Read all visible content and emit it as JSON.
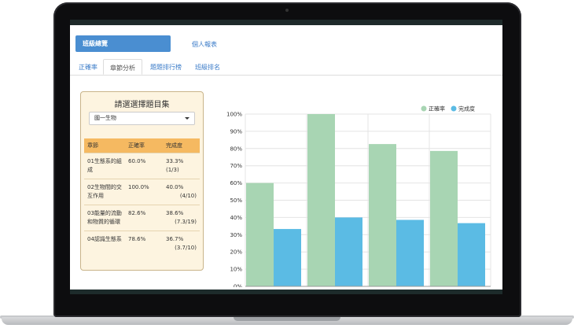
{
  "header": {
    "overview_button": "班級總覽",
    "personal_report_link": "個人報表"
  },
  "tabs": [
    {
      "label": "正確率",
      "active": false
    },
    {
      "label": "章節分析",
      "active": true
    },
    {
      "label": "題題排行榜",
      "active": false
    },
    {
      "label": "班級排名",
      "active": false
    }
  ],
  "panel": {
    "title": "請選選擇題目集",
    "select_value": "國一生物",
    "columns": [
      "章節",
      "正確率",
      "完成度"
    ],
    "rows": [
      {
        "chapter": "01生態系的組成",
        "accuracy": "60.0%",
        "completion_pct": "33.3%",
        "completion_ratio": "(1/3)"
      },
      {
        "chapter": "02生物間的交互作用",
        "accuracy": "100.0%",
        "completion_pct": "40.0%",
        "completion_ratio": "(4/10)"
      },
      {
        "chapter": "03能量的流動和物質的循環",
        "accuracy": "82.6%",
        "completion_pct": "38.6%",
        "completion_ratio": "(7.3/19)"
      },
      {
        "chapter": "04認識生態系",
        "accuracy": "78.6%",
        "completion_pct": "36.7%",
        "completion_ratio": "(3.7/10)"
      }
    ]
  },
  "colors": {
    "accuracy_series": "#a8d5b3",
    "completion_series": "#5bbbe4",
    "header_button": "#4a8ed1",
    "table_header": "#f5b961"
  },
  "chart_data": {
    "type": "bar",
    "categories": [
      "01生態系的組成",
      "02生物間的交互作用",
      "03能量的流動和物質的循環",
      "04認識生態系"
    ],
    "series": [
      {
        "name": "正確率",
        "values": [
          60.0,
          100.0,
          82.6,
          78.6
        ]
      },
      {
        "name": "完成度",
        "values": [
          33.3,
          40.0,
          38.6,
          36.7
        ]
      }
    ],
    "ylim": [
      0,
      100
    ],
    "yticks": [
      "0%",
      "10%",
      "20%",
      "30%",
      "40%",
      "50%",
      "60%",
      "70%",
      "80%",
      "90%",
      "100%"
    ],
    "grid": true,
    "legend": "top-right"
  }
}
